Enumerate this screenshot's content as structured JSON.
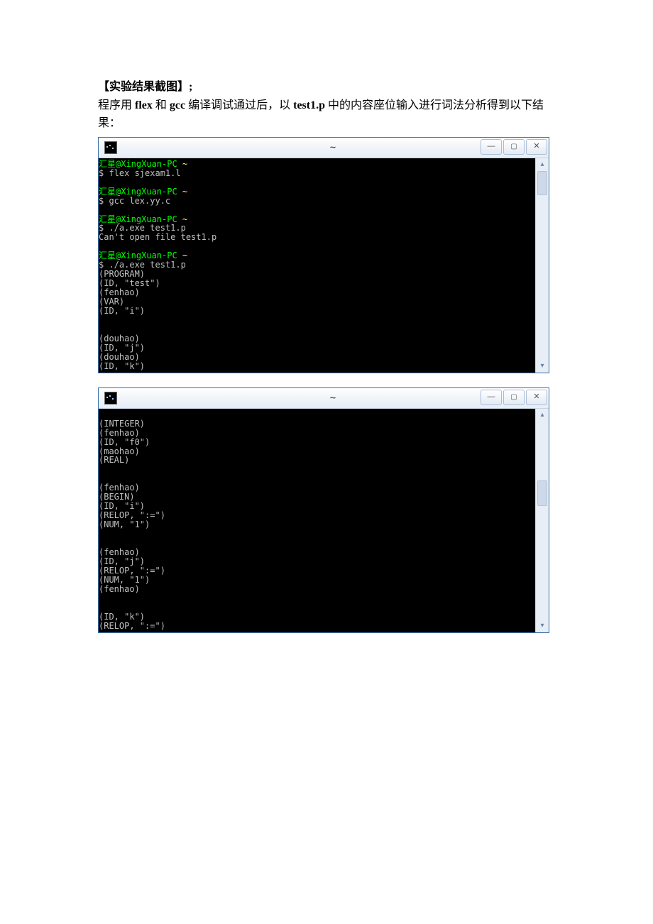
{
  "heading": "【实验结果截图】;",
  "para_prefix": "程序用 ",
  "para_flex": "flex",
  "para_mid1": " 和 ",
  "para_gcc": "gcc",
  "para_mid2": " 编译调试通过后，以 ",
  "para_test1": "test1.p",
  "para_suffix": " 中的内容座位输入进行词法分析得到以下结",
  "para_end": "果：",
  "window_title": "~",
  "term1": {
    "lines": [
      {
        "prompt": "汇星@XingXuan-PC ",
        "tilde": "~"
      },
      {
        "cmd": "$ flex sjexam1.l"
      },
      {
        "blank": ""
      },
      {
        "prompt": "汇星@XingXuan-PC ",
        "tilde": "~"
      },
      {
        "cmd": "$ gcc lex.yy.c"
      },
      {
        "blank": ""
      },
      {
        "prompt": "汇星@XingXuan-PC ",
        "tilde": "~"
      },
      {
        "cmd": "$ ./a.exe test1.p"
      },
      {
        "out": "Can't open file test1.p"
      },
      {
        "blank": ""
      },
      {
        "prompt": "汇星@XingXuan-PC ",
        "tilde": "~"
      },
      {
        "cmd": "$ ./a.exe test1.p"
      },
      {
        "out": "(PROGRAM)"
      },
      {
        "out": "(ID, \"test\")"
      },
      {
        "out": "(fenhao)"
      },
      {
        "out": "(VAR)"
      },
      {
        "out": "(ID, \"i\")"
      },
      {
        "blank": ""
      },
      {
        "blank": ""
      },
      {
        "out": "(douhao)"
      },
      {
        "out": "(ID, \"j\")"
      },
      {
        "out": "(douhao)"
      },
      {
        "out": "(ID, \"k\")"
      }
    ],
    "thumb_top": "0%",
    "thumb_height": "12%"
  },
  "term2": {
    "lines": [
      {
        "blank": ""
      },
      {
        "out": "(INTEGER)"
      },
      {
        "out": "(fenhao)"
      },
      {
        "out": "(ID, \"f0\")"
      },
      {
        "out": "(maohao)"
      },
      {
        "out": "(REAL)"
      },
      {
        "blank": ""
      },
      {
        "blank": ""
      },
      {
        "out": "(fenhao)"
      },
      {
        "out": "(BEGIN)"
      },
      {
        "out": "(ID, \"i\")"
      },
      {
        "out": "(RELOP, \":=\")"
      },
      {
        "out": "(NUM, \"1\")"
      },
      {
        "blank": ""
      },
      {
        "blank": ""
      },
      {
        "out": "(fenhao)"
      },
      {
        "out": "(ID, \"j\")"
      },
      {
        "out": "(RELOP, \":=\")"
      },
      {
        "out": "(NUM, \"1\")"
      },
      {
        "out": "(fenhao)"
      },
      {
        "blank": ""
      },
      {
        "blank": ""
      },
      {
        "out": "(ID, \"k\")"
      },
      {
        "out": "(RELOP, \":=\")"
      }
    ],
    "thumb_top": "30%",
    "thumb_height": "12%"
  }
}
